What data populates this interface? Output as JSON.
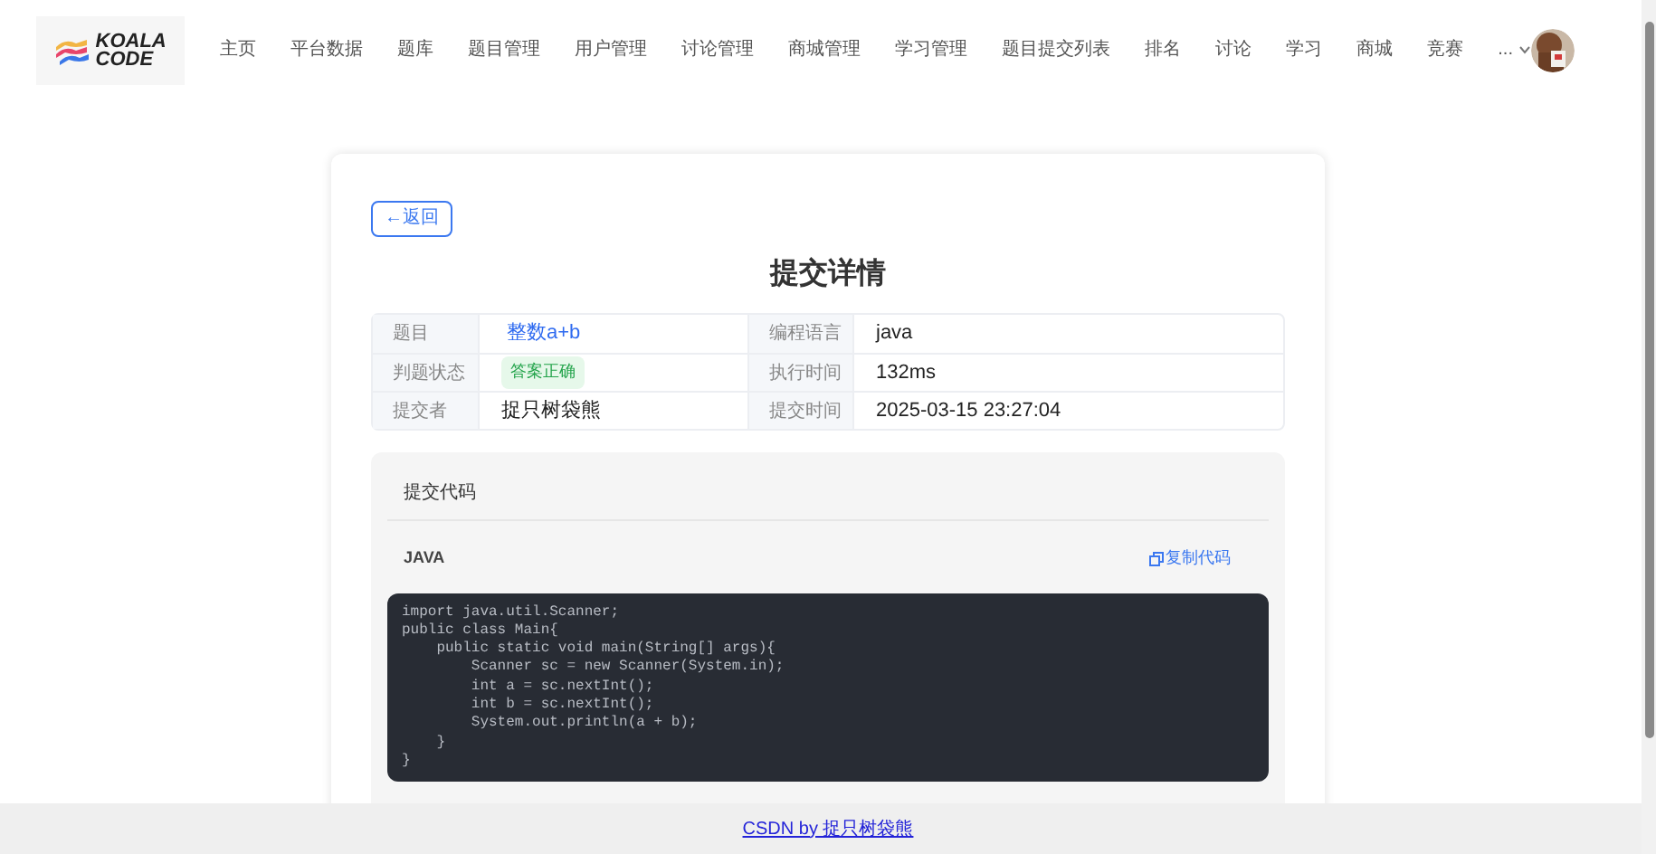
{
  "header": {
    "logo": [
      "KOALA",
      "CODE"
    ],
    "nav": [
      {
        "label": "主页"
      },
      {
        "label": "平台数据"
      },
      {
        "label": "题库"
      },
      {
        "label": "题目管理"
      },
      {
        "label": "用户管理"
      },
      {
        "label": "讨论管理"
      },
      {
        "label": "商城管理"
      },
      {
        "label": "学习管理"
      },
      {
        "label": "题目提交列表"
      },
      {
        "label": "排名"
      },
      {
        "label": "讨论"
      },
      {
        "label": "学习"
      },
      {
        "label": "商城"
      },
      {
        "label": "竞赛"
      }
    ],
    "more": "..."
  },
  "back_button": "←返回",
  "title": "提交详情",
  "details": [
    [
      {
        "label": "题目",
        "value": "整数a+b",
        "kind": "link"
      },
      {
        "label": "编程语言",
        "value": "java",
        "kind": "text"
      }
    ],
    [
      {
        "label": "判题状态",
        "value": "答案正确",
        "kind": "tag"
      },
      {
        "label": "执行时间",
        "value": "132ms",
        "kind": "text"
      }
    ],
    [
      {
        "label": "提交者",
        "value": "捉只树袋熊",
        "kind": "text"
      },
      {
        "label": "提交时间",
        "value": "2025-03-15 23:27:04",
        "kind": "text"
      }
    ]
  ],
  "code_panel": {
    "title": "提交代码",
    "language": "JAVA",
    "copy": "复制代码",
    "lines": [
      "import java.util.Scanner;",
      "public class Main{",
      "    public static void main(String[] args){",
      "        Scanner sc = new Scanner(System.in);",
      "        int a = sc.nextInt();",
      "        int b = sc.nextInt();",
      "        System.out.println(a + b);",
      "    }",
      "}"
    ]
  },
  "footer": {
    "link": "CSDN by 捉只树袋熊"
  }
}
